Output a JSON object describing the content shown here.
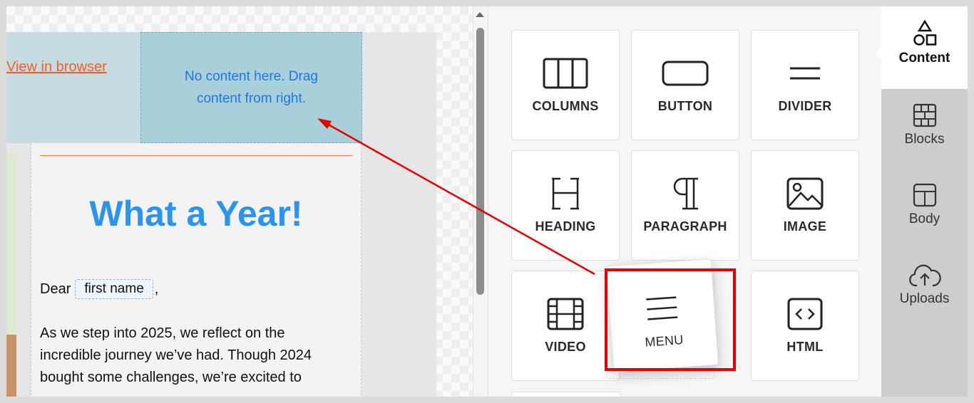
{
  "canvas": {
    "view_in_browser": "View in browser",
    "dropzone_text": "No content here. Drag content from right.",
    "headline": "What a Year!",
    "greeting_prefix": "Dear",
    "merge_tag": "first name",
    "greeting_suffix": ",",
    "body_lines": [
      "As we step into 2025, we reflect on the",
      "incredible journey we’ve had. Though 2024",
      "bought some challenges, we’re excited to"
    ]
  },
  "tools": {
    "tiles": [
      {
        "label": "COLUMNS",
        "icon": "columns-icon"
      },
      {
        "label": "BUTTON",
        "icon": "button-icon"
      },
      {
        "label": "DIVIDER",
        "icon": "divider-icon"
      },
      {
        "label": "HEADING",
        "icon": "heading-icon"
      },
      {
        "label": "PARAGRAPH",
        "icon": "paragraph-icon"
      },
      {
        "label": "IMAGE",
        "icon": "image-icon"
      },
      {
        "label": "VIDEO",
        "icon": "video-icon"
      },
      {
        "label": "MENU",
        "icon": "menu-icon"
      },
      {
        "label": "HTML",
        "icon": "html-icon"
      }
    ]
  },
  "sidebar": {
    "tabs": [
      {
        "label": "Content",
        "icon": "shapes-icon",
        "active": true
      },
      {
        "label": "Blocks",
        "icon": "bricks-icon",
        "active": false
      },
      {
        "label": "Body",
        "icon": "layout-icon",
        "active": false
      },
      {
        "label": "Uploads",
        "icon": "cloud-upload-icon",
        "active": false
      }
    ]
  },
  "colors": {
    "headline": "#2b93f0",
    "link": "#ff5a1f",
    "highlight": "#e60000",
    "arrow": "#e60000"
  }
}
